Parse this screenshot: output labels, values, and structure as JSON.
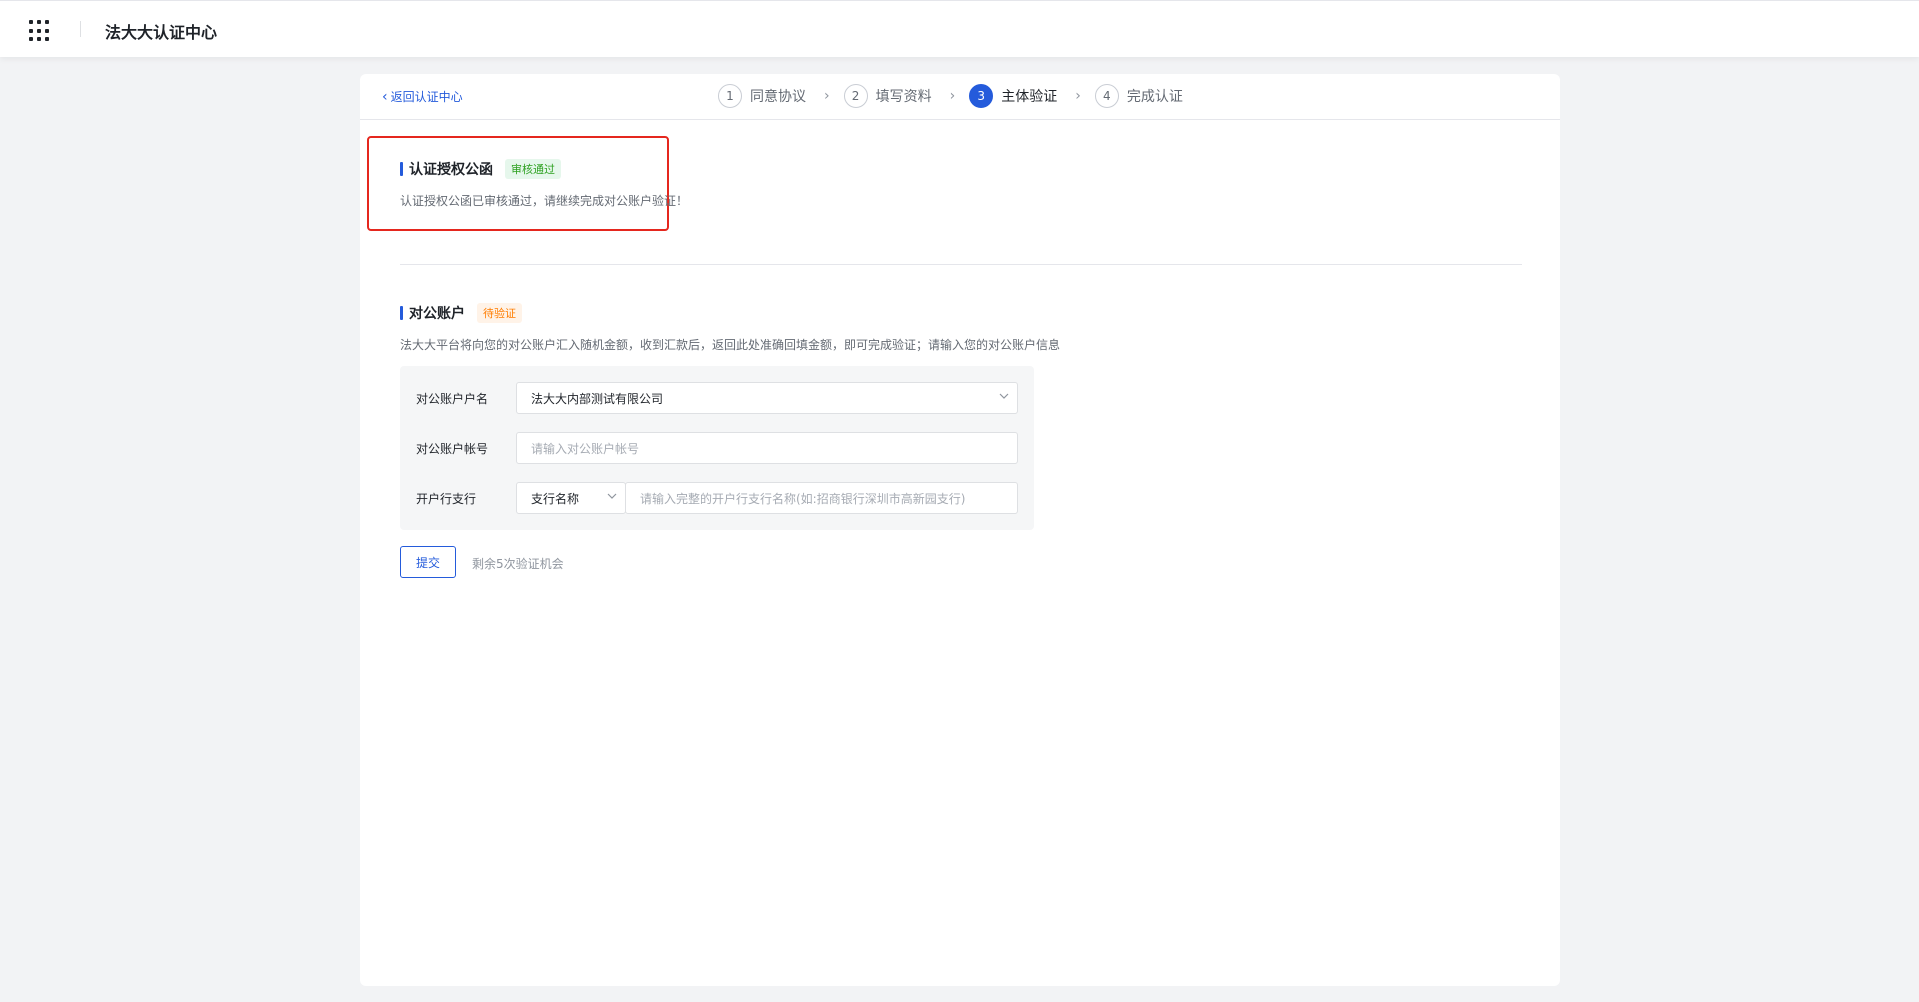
{
  "app": {
    "title": "法大大认证中心",
    "menu_icon": "grid-icon"
  },
  "header": {
    "back_label": "返回认证中心",
    "steps": [
      {
        "number": "1",
        "label": "同意协议",
        "state": "done"
      },
      {
        "number": "2",
        "label": "填写资料",
        "state": "done"
      },
      {
        "number": "3",
        "label": "主体验证",
        "state": "active"
      },
      {
        "number": "4",
        "label": "完成认证",
        "state": "pending"
      }
    ]
  },
  "auth_letter": {
    "title": "认证授权公函",
    "status": "审核通过",
    "description": "认证授权公函已审核通过，请继续完成对公账户验证！"
  },
  "corporate_account": {
    "title": "对公账户",
    "status": "待验证",
    "description": "法大大平台将向您的对公账户汇入随机金额，收到汇款后，返回此处准确回填金额，即可完成验证；请输入您的对公账户信息",
    "fields": {
      "name_label": "对公账户户名",
      "name_value": "法大大内部测试有限公司",
      "number_label": "对公账户帐号",
      "number_placeholder": "请输入对公账户帐号",
      "branch_label": "开户行支行",
      "branch_type_value": "支行名称",
      "branch_placeholder": "请输入完整的开户行支行名称(如:招商银行深圳市高新园支行)"
    },
    "submit_label": "提交",
    "remaining_text": "剩余5次验证机会"
  },
  "colors": {
    "accent": "#245bdb",
    "highlight_border": "#e5271e",
    "pass": "#2ea121",
    "pending": "#ff7d00"
  }
}
